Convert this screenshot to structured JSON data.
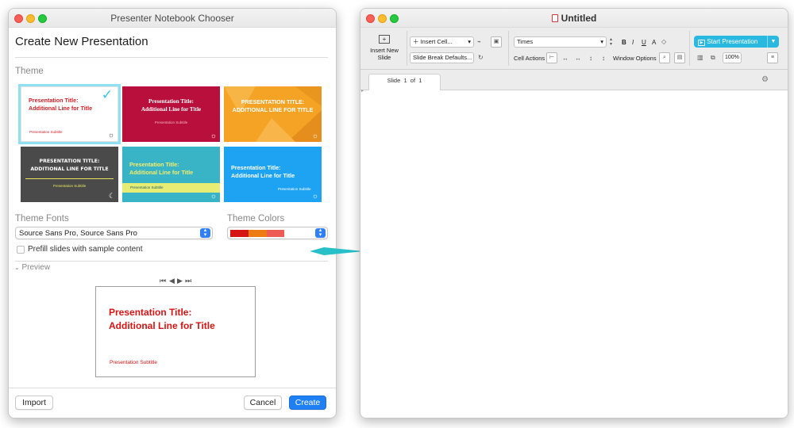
{
  "chooser": {
    "window_title": "Presenter Notebook Chooser",
    "heading": "Create New Presentation",
    "theme_label": "Theme",
    "themes": [
      {
        "title": "Presentation Title:\nAdditional Line for Title",
        "subtitle": "Presentation Subtitle",
        "background": "#ffffff",
        "title_color": "#cf1f26",
        "subtitle_color": "#cf1f26",
        "icon": "sun-icon",
        "selected": true
      },
      {
        "title": "Presentation Title:\nAdditional Line for Title",
        "subtitle": "Presentation Subtitle",
        "background": "#b80f3c",
        "title_color": "#ffffff",
        "subtitle_color": "#f2b3c2",
        "icon": "sun-icon",
        "selected": false
      },
      {
        "title": "PRESENTATION TITLE:\nADDITIONAL LINE FOR TITLE",
        "subtitle": "",
        "background": "#f4a324",
        "title_color": "#ffffff",
        "subtitle_color": "#ffffff",
        "icon": "sun-icon",
        "selected": false
      },
      {
        "title": "PRESENTATION TITLE:\nADDITIONAL LINE FOR TITLE",
        "subtitle": "Presentation Subtitle",
        "background": "#4a4a4a",
        "title_color": "#ffffff",
        "subtitle_color": "#e8e35c",
        "icon": "moon-icon",
        "selected": false
      },
      {
        "title": "Presentation Title:\nAdditional Line for Title",
        "subtitle": "Presentation Subtitle",
        "background": "#39b4c6",
        "title_color": "#f5ec6a",
        "subtitle_color": "#1f5f69",
        "icon": "sun-icon",
        "selected": false
      },
      {
        "title": "Presentation Title:\nAdditional Line for Title",
        "subtitle": "Presentation Subtitle",
        "background": "#1ea3f3",
        "title_color": "#ffffff",
        "subtitle_color": "#ffffff",
        "icon": "sun-icon",
        "selected": false
      }
    ],
    "theme_fonts_label": "Theme Fonts",
    "theme_fonts_value": "Source Sans Pro, Source Sans Pro",
    "theme_colors_label": "Theme Colors",
    "theme_colors": [
      "#d61414",
      "#ed7a12",
      "#ef5b55"
    ],
    "prefill_label": "Prefill slides with sample content",
    "prefill_checked": false,
    "preview_label": "Preview",
    "preview": {
      "title_line1": "Presentation Title:",
      "title_line2": "Additional Line for Title",
      "subtitle": "Presentation Subtitle",
      "accent_color": "#d61414"
    },
    "import_label": "Import",
    "cancel_label": "Cancel",
    "create_label": "Create"
  },
  "arrow_color": "#27bfc8",
  "notebook": {
    "window_title": "Untitled",
    "toolbar": {
      "insert_new_slide_line1": "Insert New",
      "insert_new_slide_line2": "Slide",
      "insert_cell": "Insert Cell...",
      "slide_break_defaults": "Slide Break Defaults...",
      "font_name": "Times",
      "cell_actions": "Cell Actions",
      "window_options": "Window Options",
      "start_presentation": "Start Presentation",
      "zoom": "100%",
      "style_bold": "B",
      "style_italic": "I",
      "style_underline": "U",
      "style_font_size": "A",
      "accent_color": "#28b8e0"
    },
    "tab": {
      "slide_word": "Slide",
      "slide_number": "1",
      "of_word": "of",
      "slide_total": "1"
    }
  }
}
